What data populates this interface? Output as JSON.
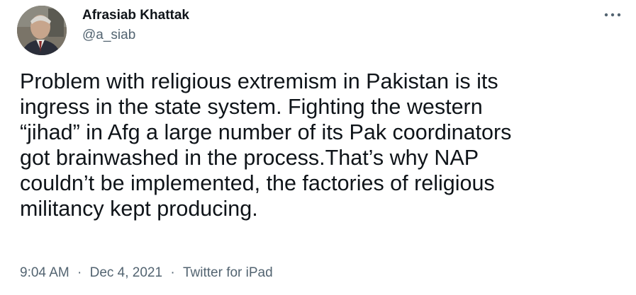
{
  "author": {
    "display_name": "Afrasiab Khattak",
    "handle": "@a_siab"
  },
  "tweet": {
    "text": "Problem with religious extremism in Pakistan is its\ningress in the state system. Fighting the western\n“jihad” in Afg  a large number of its Pak coordinators\ngot brainwashed in the process.That’s why NAP\ncouldn’t be implemented, the factories of religious\nmilitancy kept producing."
  },
  "meta": {
    "time": "9:04 AM",
    "separator": "·",
    "date": "Dec 4, 2021",
    "source": "Twitter for iPad"
  },
  "icons": {
    "more": "more-options-icon"
  },
  "colors": {
    "text_primary": "#0f1419",
    "text_secondary": "#536471",
    "background": "#ffffff"
  }
}
